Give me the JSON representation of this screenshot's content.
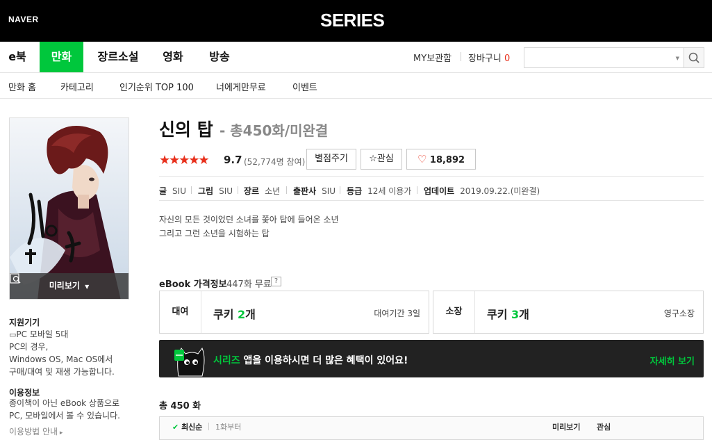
{
  "header": {
    "naver_label": "NAVER",
    "brand": "SERIES"
  },
  "gnb": {
    "items": [
      {
        "label": "e북"
      },
      {
        "label": "만화",
        "active": true
      },
      {
        "label": "장르소설"
      },
      {
        "label": "영화"
      },
      {
        "label": "방송"
      }
    ],
    "my_library": "MY보관함",
    "cart_label": "장바구니",
    "cart_count": "0",
    "search_placeholder": ""
  },
  "lnb": {
    "items": [
      "만화 홈",
      "카테고리",
      "인기순위 TOP 100",
      "너에게만무료",
      "이벤트"
    ]
  },
  "cover": {
    "preview_label": "미리보기"
  },
  "sidebar": {
    "support_title": "지원기기",
    "devices": "PC  모바일 5대",
    "pc_note": [
      "PC의 경우,",
      "Windows OS, Mac OS에서",
      "구매/대여 및 재생 가능합니다."
    ],
    "usage_title": "이용정보",
    "usage_note": [
      "종이책이 아닌 eBook 상품으로",
      "PC, 모바일에서 볼 수 있습니다."
    ],
    "usage_link": "이용방법 안내"
  },
  "product": {
    "title": "신의 탑",
    "subtitle": "- 총450화/미완결",
    "stars": "★★★★★",
    "rating": "9.7",
    "rating_count": "(52,774명 참여)",
    "rate_button": "별점주기",
    "interest_button": "관심",
    "like_count": "18,892",
    "meta": [
      {
        "key": "글",
        "value": "SIU"
      },
      {
        "key": "그림",
        "value": "SIU"
      },
      {
        "key": "장르",
        "value": "소년"
      },
      {
        "key": "출판사",
        "value": "SIU"
      },
      {
        "key": "등급",
        "value": "12세 이용가"
      },
      {
        "key": "업데이트",
        "value": "2019.09.22.(미완결)"
      }
    ],
    "description": [
      "자신의 모든 것이었던 소녀를 쫓아 탑에 들어온 소년",
      "그리고 그런 소년을 시험하는 탑"
    ]
  },
  "pricing": {
    "title": "eBook 가격정보",
    "free_info": "447화 무료",
    "help": "?",
    "rent": {
      "label": "대여",
      "prefix": "쿠키 ",
      "amount": "2",
      "suffix": "개",
      "note": "대여기간 3일"
    },
    "own": {
      "label": "소장",
      "prefix": "쿠키 ",
      "amount": "3",
      "suffix": "개",
      "note": "영구소장"
    }
  },
  "banner": {
    "brand": "시리즈",
    "text": " 앱을 이용하시면 더 많은 혜택이 있어요!",
    "more": "자세히 보기"
  },
  "episodes": {
    "total": "총 450 화",
    "sort_latest": "최신순",
    "sort_first": "1화부터",
    "col_preview": "미리보기",
    "col_interest": "관심"
  },
  "colors": {
    "accent": "#00c73c",
    "red": "#e8301c",
    "topbar": "#000000"
  }
}
